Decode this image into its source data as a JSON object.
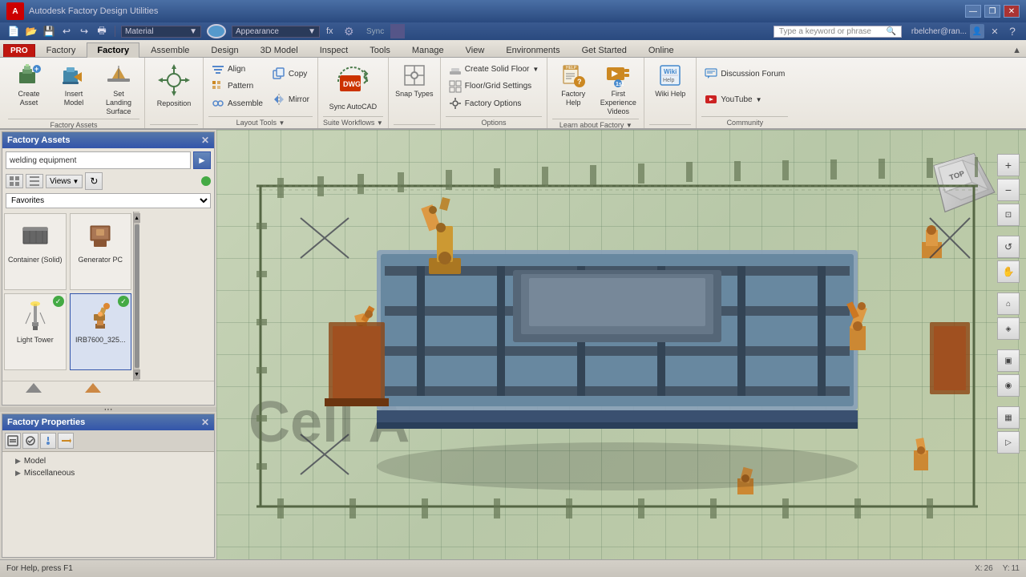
{
  "titlebar": {
    "app_name": "Autodesk Factory Design Utilities",
    "user": "rbelcher@ran...",
    "minimize": "—",
    "restore": "❐",
    "close": "✕",
    "pro_label": "PRO"
  },
  "quickaccess": {
    "material_label": "Material",
    "appearance_label": "Appearance",
    "sync_label": "Sync",
    "search_placeholder": "Type a keyword or phrase"
  },
  "ribbon_tabs": [
    {
      "id": "pro",
      "label": "PRO"
    },
    {
      "id": "factory",
      "label": "Factory",
      "active": true
    },
    {
      "id": "assemble",
      "label": "Assemble"
    },
    {
      "id": "design",
      "label": "Design"
    },
    {
      "id": "3dmodel",
      "label": "3D Model"
    },
    {
      "id": "inspect",
      "label": "Inspect"
    },
    {
      "id": "tools",
      "label": "Tools"
    },
    {
      "id": "manage",
      "label": "Manage"
    },
    {
      "id": "view",
      "label": "View"
    },
    {
      "id": "environments",
      "label": "Environments"
    },
    {
      "id": "get_started",
      "label": "Get Started"
    },
    {
      "id": "online",
      "label": "Online"
    }
  ],
  "ribbon": {
    "groups": [
      {
        "id": "factory-assets",
        "label": "Factory Assets",
        "buttons": [
          {
            "id": "create-asset",
            "label": "Create Asset",
            "size": "large"
          },
          {
            "id": "insert-model",
            "label": "Insert Model",
            "size": "large"
          },
          {
            "id": "set-landing",
            "label": "Set Landing Surface",
            "size": "large"
          }
        ]
      },
      {
        "id": "reposition",
        "label": "",
        "buttons": [
          {
            "id": "reposition",
            "label": "Reposition",
            "size": "large"
          }
        ]
      },
      {
        "id": "layout-tools",
        "label": "Layout Tools",
        "buttons_small": [
          {
            "id": "align",
            "label": "Align"
          },
          {
            "id": "pattern",
            "label": "Pattern"
          },
          {
            "id": "assemble",
            "label": "Assemble"
          },
          {
            "id": "copy",
            "label": "Copy"
          },
          {
            "id": "mirror",
            "label": "Mirror"
          }
        ]
      },
      {
        "id": "suite-workflows",
        "label": "Suite Workflows",
        "buttons": [
          {
            "id": "sync-autocad",
            "label": "Sync AutoCAD",
            "size": "large"
          }
        ]
      },
      {
        "id": "snap",
        "label": "",
        "buttons": [
          {
            "id": "snap-types",
            "label": "Snap Types",
            "size": "large"
          }
        ]
      },
      {
        "id": "options",
        "label": "Options",
        "buttons_small": [
          {
            "id": "create-solid-floor",
            "label": "Create Solid Floor"
          },
          {
            "id": "floor-grid-settings",
            "label": "Floor/Grid Settings"
          },
          {
            "id": "factory-options",
            "label": "Factory Options"
          }
        ]
      },
      {
        "id": "learn",
        "label": "Learn about Factory",
        "buttons": [
          {
            "id": "factory-help",
            "label": "Factory Help",
            "size": "large"
          },
          {
            "id": "first-experience",
            "label": "First Experience Videos",
            "size": "large"
          }
        ]
      },
      {
        "id": "wiki",
        "label": "",
        "buttons": [
          {
            "id": "wiki-help",
            "label": "Wiki Help",
            "size": "large"
          }
        ]
      },
      {
        "id": "community",
        "label": "Community",
        "buttons_small": [
          {
            "id": "discussion-forum",
            "label": "Discussion Forum"
          },
          {
            "id": "youtube",
            "label": "YouTube"
          }
        ]
      }
    ]
  },
  "factory_assets": {
    "title": "Factory Assets",
    "search_value": "welding equipment",
    "views_label": "Views",
    "favorites_value": "Favorites",
    "items": [
      {
        "id": "container-solid",
        "label": "Container (Solid)",
        "has_check": false
      },
      {
        "id": "generator-pc",
        "label": "Generator PC",
        "has_check": false
      },
      {
        "id": "light-tower",
        "label": "Light Tower",
        "has_check": true
      },
      {
        "id": "irb7600",
        "label": "IRB7600_325...",
        "has_check": true,
        "selected": true
      }
    ]
  },
  "factory_properties": {
    "title": "Factory Properties",
    "tree": [
      {
        "id": "model",
        "label": "Model",
        "indent": 0
      },
      {
        "id": "miscellaneous",
        "label": "Miscellaneous",
        "indent": 0
      }
    ]
  },
  "viewport": {
    "cell_label": "Cell A"
  },
  "statusbar": {
    "help_text": "For Help, press F1",
    "coord_x": "26",
    "coord_y": "11"
  }
}
